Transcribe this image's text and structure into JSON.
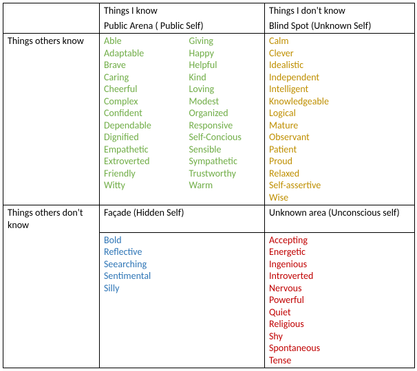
{
  "headers": {
    "col_known": "Things I know",
    "col_unknown": "Things I don't know",
    "row_known": "Things others know",
    "row_unknown": "Things others don't know"
  },
  "quadrants": {
    "public": {
      "title": "Public Arena ( Public Self)"
    },
    "blind": {
      "title": "Blind Spot (Unknown Self)"
    },
    "facade": {
      "title": "Façade (Hidden Self)"
    },
    "unknown": {
      "title": "Unknown area (Unconscious self)"
    }
  },
  "public_col1": {
    "0": "Able",
    "1": "Adaptable",
    "2": "Brave",
    "3": "Caring",
    "4": "Cheerful",
    "5": "Complex",
    "6": "Confident",
    "7": "Dependable",
    "8": "Dignified",
    "9": "Empathetic",
    "10": "Extroverted",
    "11": "Friendly",
    "12": "Witty"
  },
  "public_col2": {
    "0": "Giving",
    "1": "Happy",
    "2": "Helpful",
    "3": "Kind",
    "4": "Loving",
    "5": "Modest",
    "6": "Organized",
    "7": "Responsive",
    "8": "Self-Concious",
    "9": "Sensible",
    "10": "Sympathetic",
    "11": "Trustworthy",
    "12": "Warm"
  },
  "blind": {
    "0": "Calm",
    "1": "Clever",
    "2": "Idealistic",
    "3": "Independent",
    "4": "Intelligent",
    "5": "Knowledgeable",
    "6": "Logical",
    "7": "Mature",
    "8": "Observant",
    "9": "Patient",
    "10": "Proud",
    "11": "Relaxed",
    "12": "Self-assertive",
    "13": "Wise"
  },
  "facade": {
    "0": "Bold",
    "1": "Reflective",
    "2": "Seearching",
    "3": "Sentimental",
    "4": "Silly"
  },
  "unknown": {
    "0": "Accepting",
    "1": "Energetic",
    "2": "Ingenious",
    "3": "Introverted",
    "4": "Nervous",
    "5": "Powerful",
    "6": "Quiet",
    "7": "Religious",
    "8": "Shy",
    "9": "Spontaneous",
    "10": "Tense"
  }
}
